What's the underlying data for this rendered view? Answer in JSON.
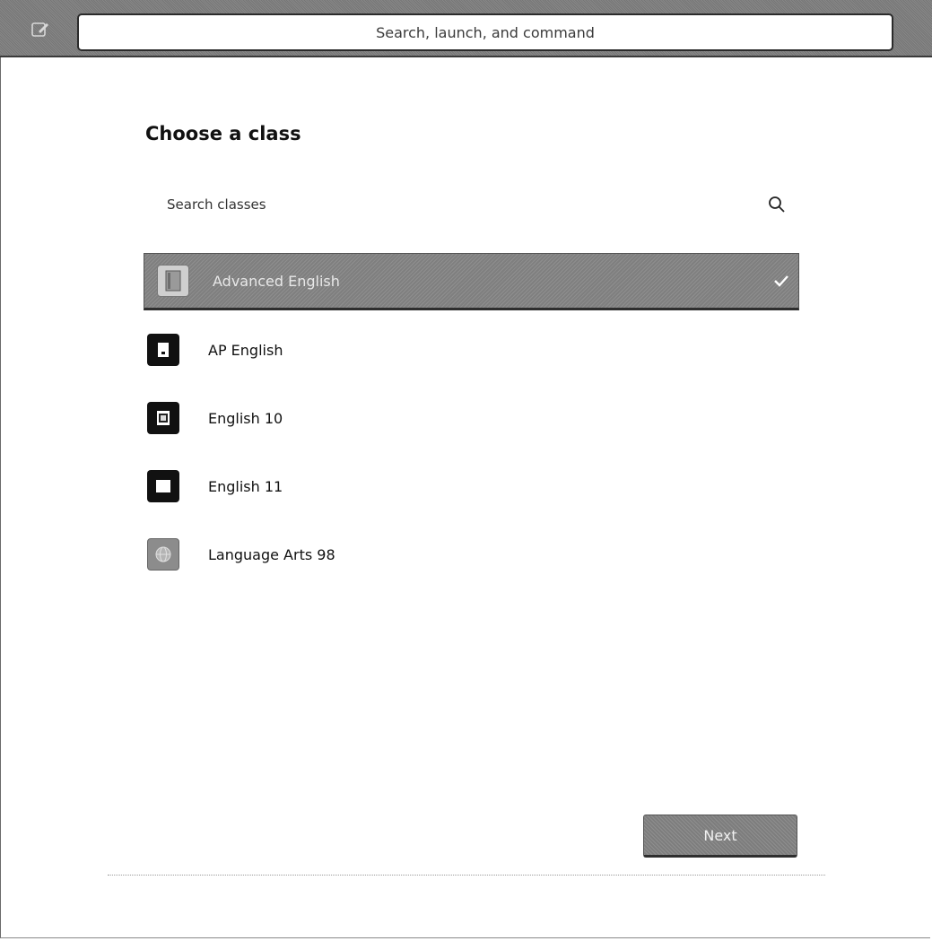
{
  "topbar": {
    "compose_icon": "compose-icon",
    "search_placeholder": "Search, launch, and command"
  },
  "dialog": {
    "title": "Choose a class",
    "search": {
      "placeholder": "Search classes",
      "icon": "search-icon"
    },
    "classes": [
      {
        "label": "Advanced English",
        "selected": true,
        "icon": "notebook-icon",
        "icon_color": "#bdbdbd"
      },
      {
        "label": "AP English",
        "selected": false,
        "icon": "notebook-icon",
        "icon_color": "#1a1a1a"
      },
      {
        "label": "English 10",
        "selected": false,
        "icon": "notebook-icon",
        "icon_color": "#1a1a1a"
      },
      {
        "label": "English 11",
        "selected": false,
        "icon": "notebook-icon",
        "icon_color": "#1a1a1a"
      },
      {
        "label": "Language Arts 98",
        "selected": false,
        "icon": "globe-icon",
        "icon_color": "#8a8a8a"
      }
    ],
    "next_label": "Next"
  },
  "colors": {
    "selected_bg": "#868686",
    "topbar_bg": "#7d7d7d",
    "button_bg": "#858585"
  }
}
